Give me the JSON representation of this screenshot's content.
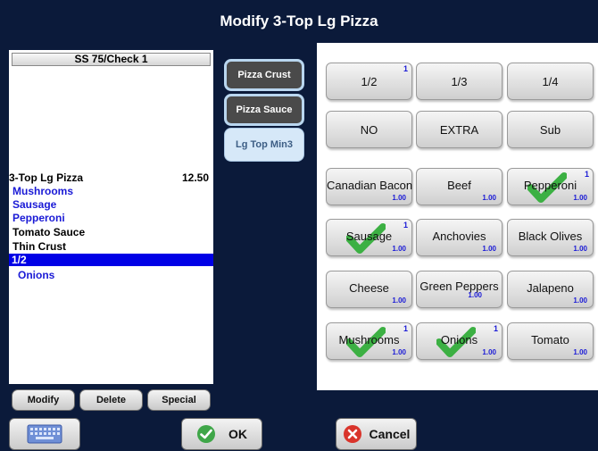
{
  "title": "Modify 3-Top Lg Pizza",
  "check": {
    "header": "SS 75/Check 1",
    "lines": [
      {
        "text": "3-Top Lg Pizza",
        "amount": "12.50"
      },
      {
        "text": "Mushrooms"
      },
      {
        "text": "Sausage"
      },
      {
        "text": "Pepperoni"
      },
      {
        "text": "Tomato Sauce"
      },
      {
        "text": "Thin Crust"
      },
      {
        "text": "1/2"
      },
      {
        "text": "Onions"
      }
    ]
  },
  "actions": {
    "modify": "Modify",
    "delete": "Delete",
    "special": "Special"
  },
  "categories": [
    "Pizza Crust",
    "Pizza Sauce",
    "Lg Top Min3"
  ],
  "portions": [
    {
      "label": "1/2",
      "count": "1"
    },
    {
      "label": "1/3"
    },
    {
      "label": "1/4"
    }
  ],
  "qualifiers": [
    "NO",
    "EXTRA",
    "Sub"
  ],
  "toppings": [
    {
      "label": "Canadian Bacon",
      "price": "1.00",
      "count": "",
      "checked": false
    },
    {
      "label": "Beef",
      "price": "1.00",
      "count": "",
      "checked": false
    },
    {
      "label": "Pepperoni",
      "price": "1.00",
      "count": "1",
      "checked": true
    },
    {
      "label": "Sausage",
      "price": "1.00",
      "count": "1",
      "checked": true
    },
    {
      "label": "Anchovies",
      "price": "1.00",
      "count": "",
      "checked": false
    },
    {
      "label": "Black Olives",
      "price": "1.00",
      "count": "",
      "checked": false
    },
    {
      "label": "Cheese",
      "price": "1.00",
      "count": "",
      "checked": false
    },
    {
      "label": "Green Peppers",
      "price": "1.00",
      "count": "",
      "checked": false
    },
    {
      "label": "Jalapeno",
      "price": "1.00",
      "count": "",
      "checked": false
    },
    {
      "label": "Mushrooms",
      "price": "1.00",
      "count": "1",
      "checked": true
    },
    {
      "label": "Onions",
      "price": "1.00",
      "count": "1",
      "checked": true
    },
    {
      "label": "Tomato",
      "price": "1.00",
      "count": "",
      "checked": false
    }
  ],
  "bottom": {
    "ok": "OK",
    "cancel": "Cancel",
    "keyboard_icon": "keyboard-icon"
  },
  "colors": {
    "background": "#0b1a3a",
    "selected_line": "#0000e6",
    "modifier_text": "#1a1ad6",
    "check_green": "#3cb043",
    "cancel_red": "#d9342b"
  }
}
